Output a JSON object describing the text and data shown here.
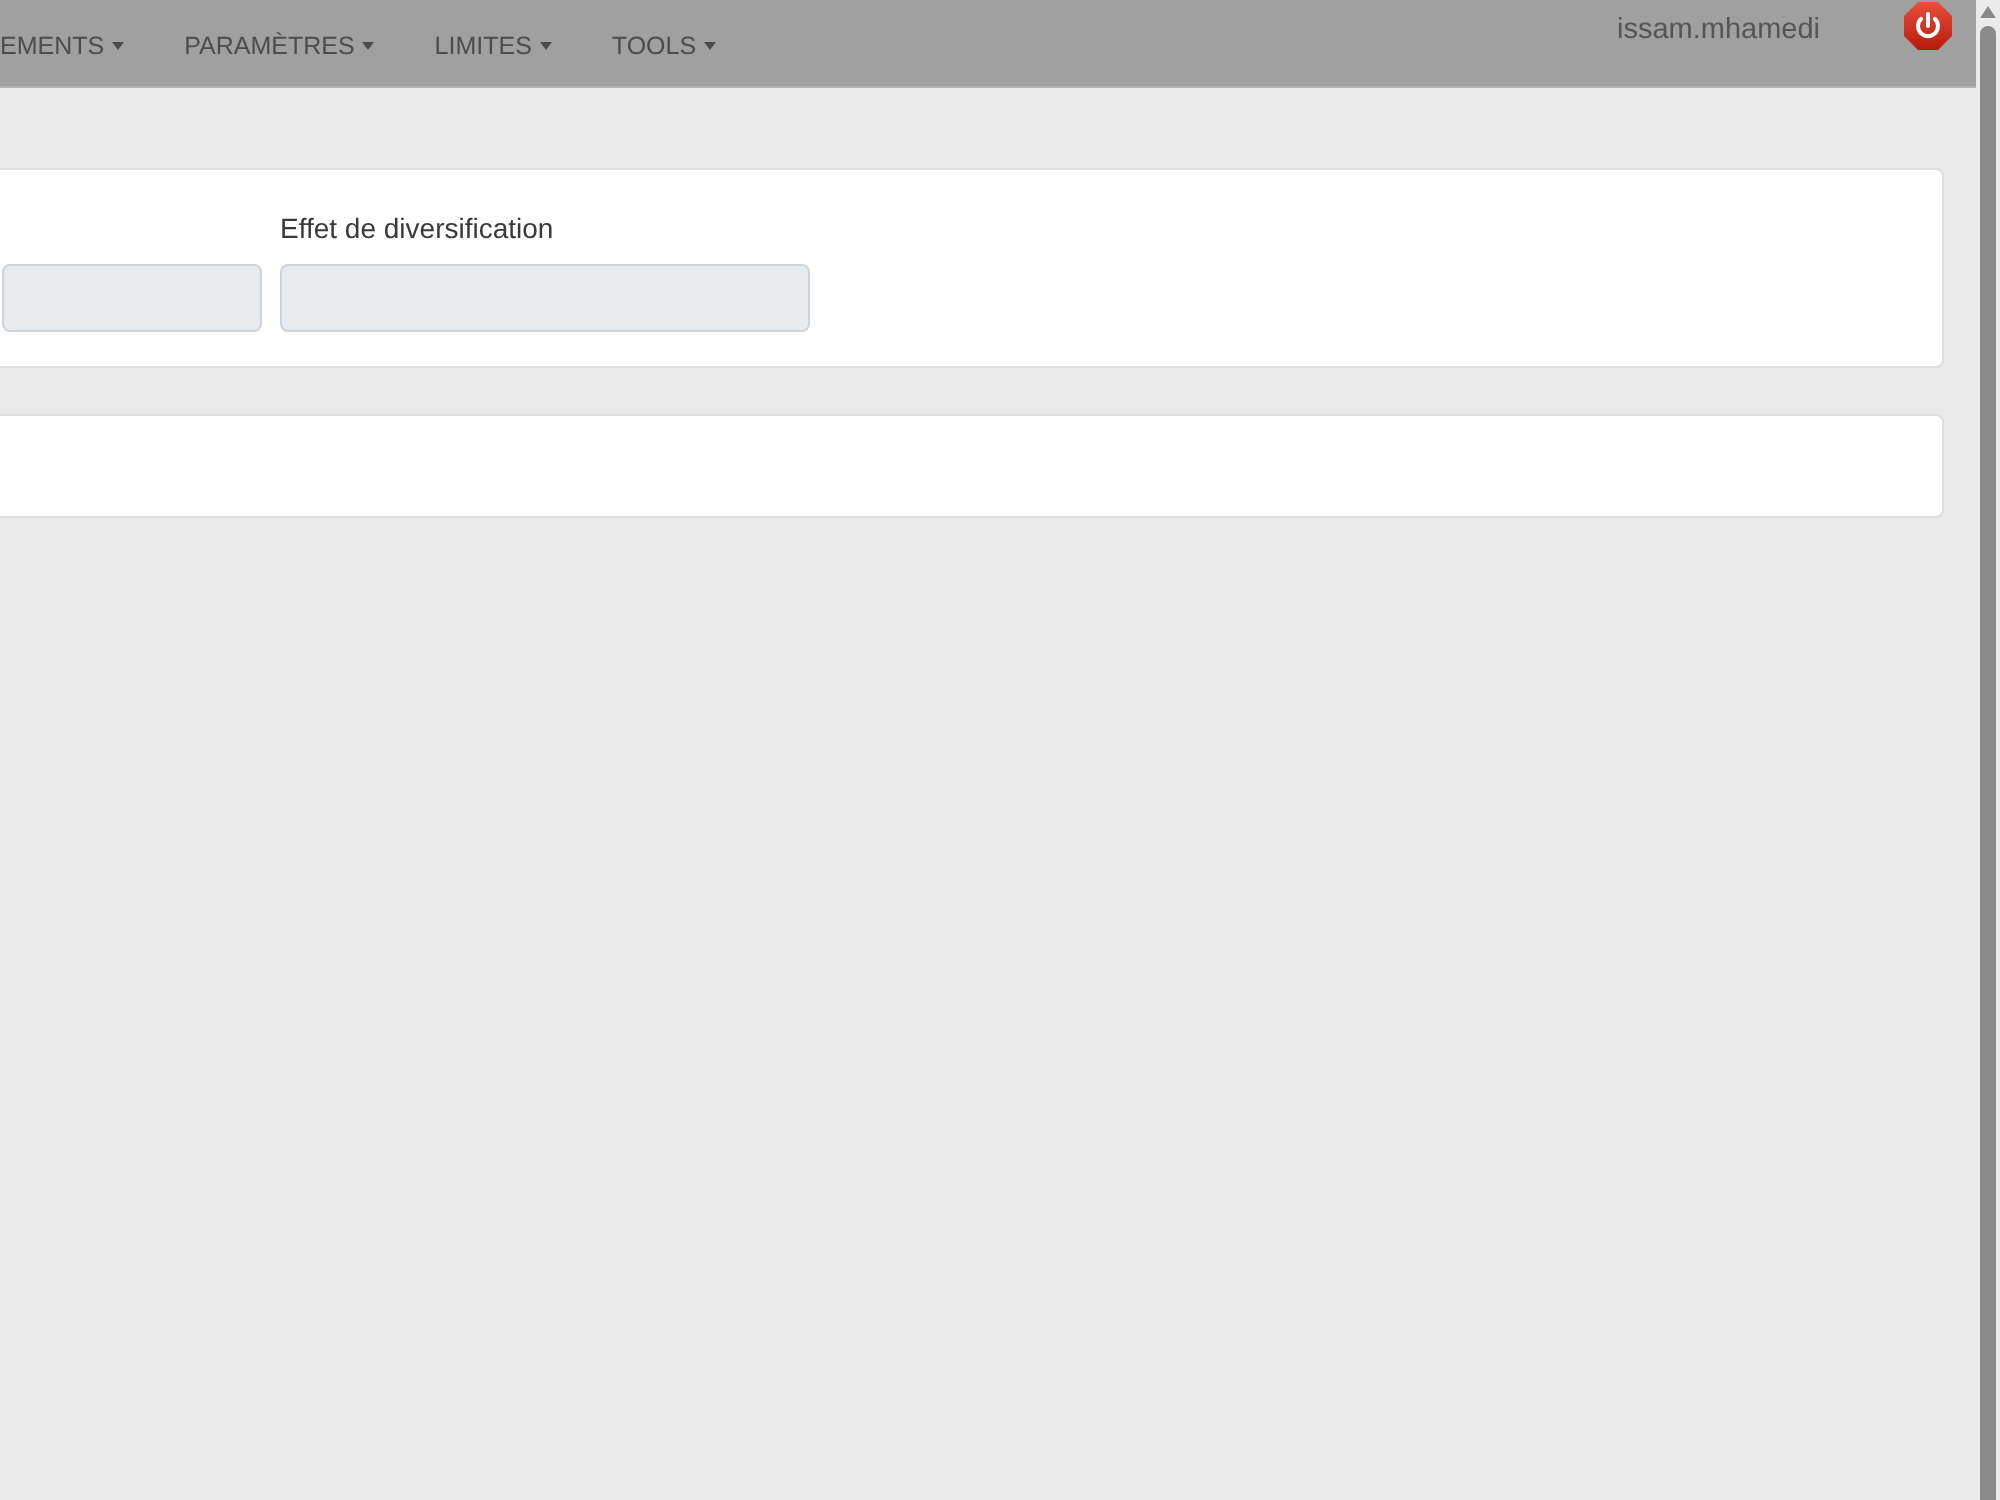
{
  "navbar": {
    "menus": [
      {
        "label": "EMENTS"
      },
      {
        "label": "PARAMÈTRES"
      },
      {
        "label": "LIMITES"
      },
      {
        "label": "TOOLS"
      }
    ],
    "user": "issam.mhamedi"
  },
  "form_card": {
    "fields": [
      {
        "disabled": true
      },
      {
        "label": "Effet de diversification",
        "disabled": true
      }
    ]
  }
}
